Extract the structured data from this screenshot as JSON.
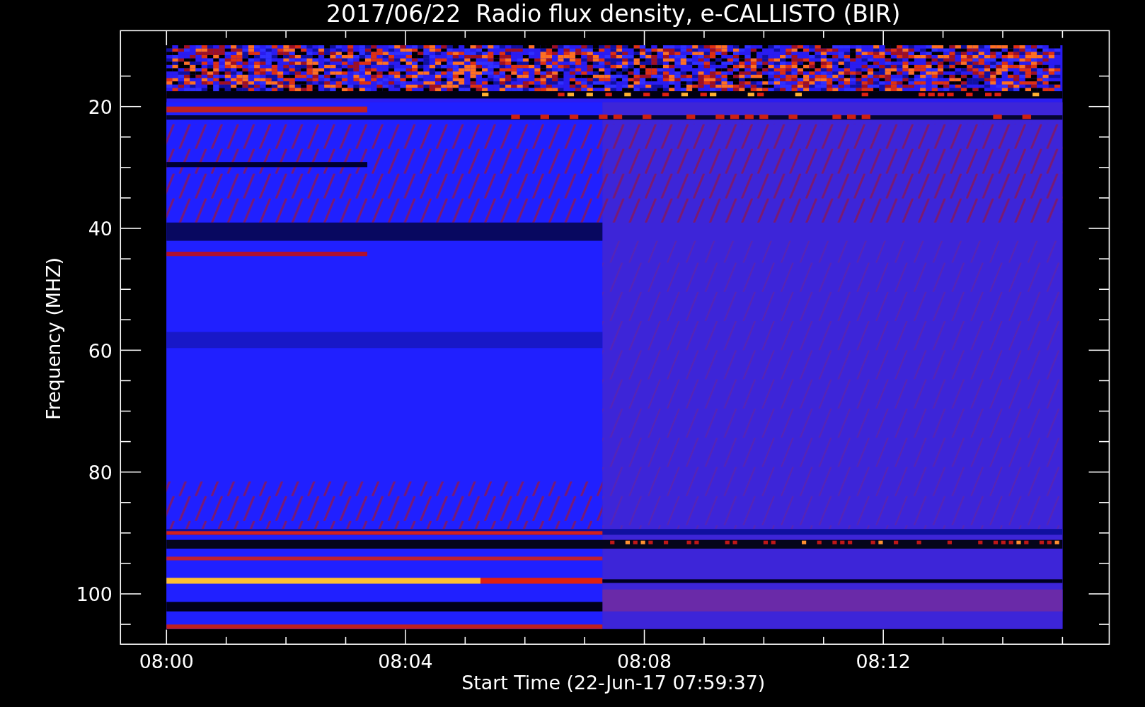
{
  "title": "2017/06/22  Radio flux density, e-CALLISTO (BIR)",
  "y_axis": {
    "label": "Frequency (MHZ)",
    "ticks": [
      "20",
      "40",
      "60",
      "80",
      "100"
    ]
  },
  "x_axis": {
    "label": "Start Time (22-Jun-17 07:59:37)",
    "ticks": [
      "08:00",
      "08:04",
      "08:08",
      "08:12"
    ]
  }
}
